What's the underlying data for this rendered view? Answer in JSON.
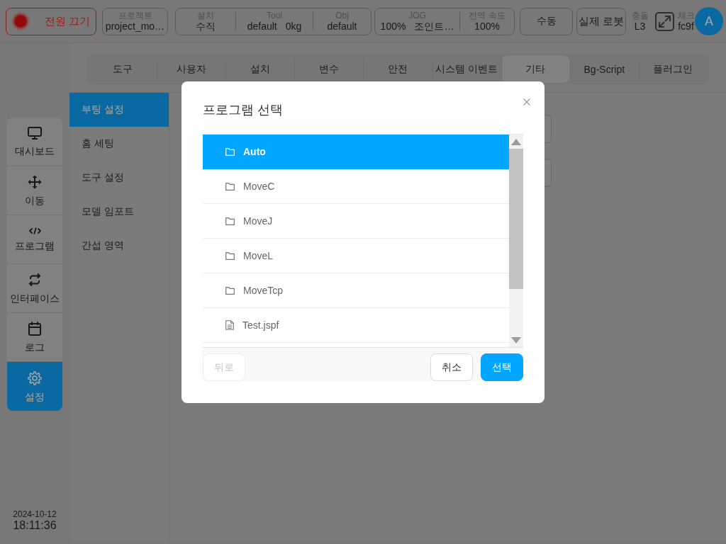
{
  "top_bar": {
    "power_button": "전원 끄기",
    "project": {
      "label": "프로젝트",
      "value": "project_mo…"
    },
    "install": [
      {
        "label": "설치",
        "values": [
          "수직"
        ]
      },
      {
        "label": "Tool",
        "values": [
          "default",
          "0kg"
        ]
      },
      {
        "label": "Obj",
        "values": [
          "default"
        ]
      }
    ],
    "speed": [
      {
        "label": "JOG",
        "values": [
          "100%",
          "조인트…"
        ]
      },
      {
        "label": "전역 속도",
        "values": [
          "100%"
        ]
      }
    ],
    "mode_button": "수동",
    "robot_button": "실제 로봇",
    "collision": {
      "label": "충돌",
      "value": "L3"
    },
    "check": {
      "label": "체크",
      "value": "fc9f"
    },
    "avatar": "A"
  },
  "tabs": [
    {
      "label": "도구",
      "selected": false
    },
    {
      "label": "사용자",
      "selected": false
    },
    {
      "label": "설치",
      "selected": false
    },
    {
      "label": "변수",
      "selected": false
    },
    {
      "label": "안전",
      "selected": false
    },
    {
      "label": "시스템 이벤트",
      "selected": false
    },
    {
      "label": "기타",
      "selected": true
    },
    {
      "label": "Bg-Script",
      "selected": false
    },
    {
      "label": "플러그인",
      "selected": false
    }
  ],
  "sidebar": {
    "items": [
      {
        "label": "대시보드",
        "selected": false
      },
      {
        "label": "이동",
        "selected": false
      },
      {
        "label": "프로그램",
        "selected": false
      },
      {
        "label": "인터페이스",
        "selected": false
      },
      {
        "label": "로그",
        "selected": false
      },
      {
        "label": "설정",
        "selected": true
      }
    ],
    "date": "2024-10-12",
    "time": "18:11:36"
  },
  "settings_menu": [
    {
      "label": "부팅 설정",
      "selected": true
    },
    {
      "label": "홈 세팅",
      "selected": false
    },
    {
      "label": "도구 설정",
      "selected": false
    },
    {
      "label": "모델 임포트",
      "selected": false
    },
    {
      "label": "간섭 영역",
      "selected": false
    }
  ],
  "dialog": {
    "title": "프로그램 선택",
    "rows": [
      {
        "kind": "folder",
        "name": "Auto",
        "selected": true
      },
      {
        "kind": "folder",
        "name": "MoveC",
        "selected": false
      },
      {
        "kind": "folder",
        "name": "MoveJ",
        "selected": false
      },
      {
        "kind": "folder",
        "name": "MoveL",
        "selected": false
      },
      {
        "kind": "folder",
        "name": "MoveTcp",
        "selected": false
      },
      {
        "kind": "file",
        "name": "Test.jspf",
        "selected": false
      }
    ],
    "buttons": [
      {
        "label": "뒤로",
        "kind": "default",
        "disabled": true
      },
      {
        "label": "취소",
        "kind": "default",
        "disabled": false
      },
      {
        "label": "선택",
        "kind": "primary",
        "disabled": false
      }
    ]
  }
}
